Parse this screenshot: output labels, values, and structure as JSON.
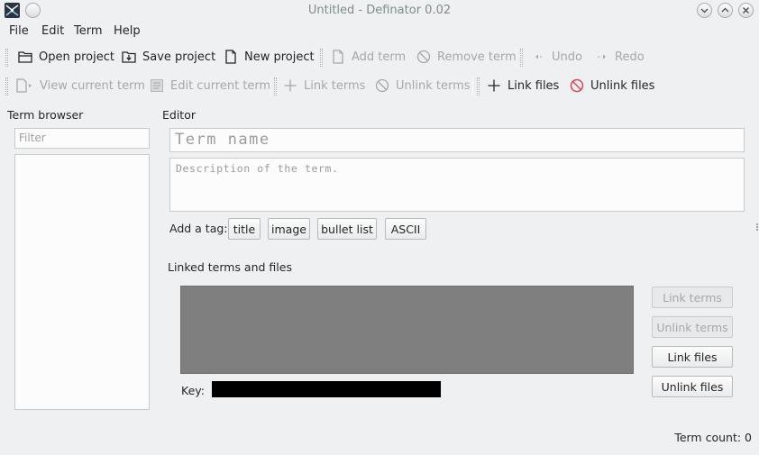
{
  "window": {
    "title": "Untitled - Definator 0.02"
  },
  "menu": [
    "File",
    "Edit",
    "Term",
    "Help"
  ],
  "toolbar1": {
    "open_project": "Open project",
    "save_project": "Save project",
    "new_project": "New project",
    "add_term": "Add term",
    "remove_term": "Remove term",
    "undo": "Undo",
    "redo": "Redo"
  },
  "toolbar2": {
    "view_current_term": "View current term",
    "edit_current_term": "Edit current term",
    "link_terms": "Link terms",
    "unlink_terms": "Unlink terms",
    "link_files": "Link files",
    "unlink_files": "Unlink files"
  },
  "term_browser": {
    "label": "Term browser",
    "filter_placeholder": "Filter"
  },
  "editor": {
    "label": "Editor",
    "term_name_placeholder": "Term name",
    "description_placeholder": "Description of the term.",
    "add_tag_label": "Add a tag:",
    "tags": [
      "title",
      "image",
      "bullet list",
      "ASCII"
    ]
  },
  "linked": {
    "label": "Linked terms and files",
    "key_label": "Key:",
    "buttons": {
      "link_terms": "Link terms",
      "unlink_terms": "Unlink terms",
      "link_files": "Link files",
      "unlink_files": "Unlink files"
    }
  },
  "status": {
    "term_count": "Term count: 0"
  },
  "colors": {
    "background": "#eff0f1",
    "disabled_text": "#a5a8aa",
    "linked_area": "#7f7f7f",
    "key_bar": "#000000",
    "unlink_icon": "#da4453"
  }
}
